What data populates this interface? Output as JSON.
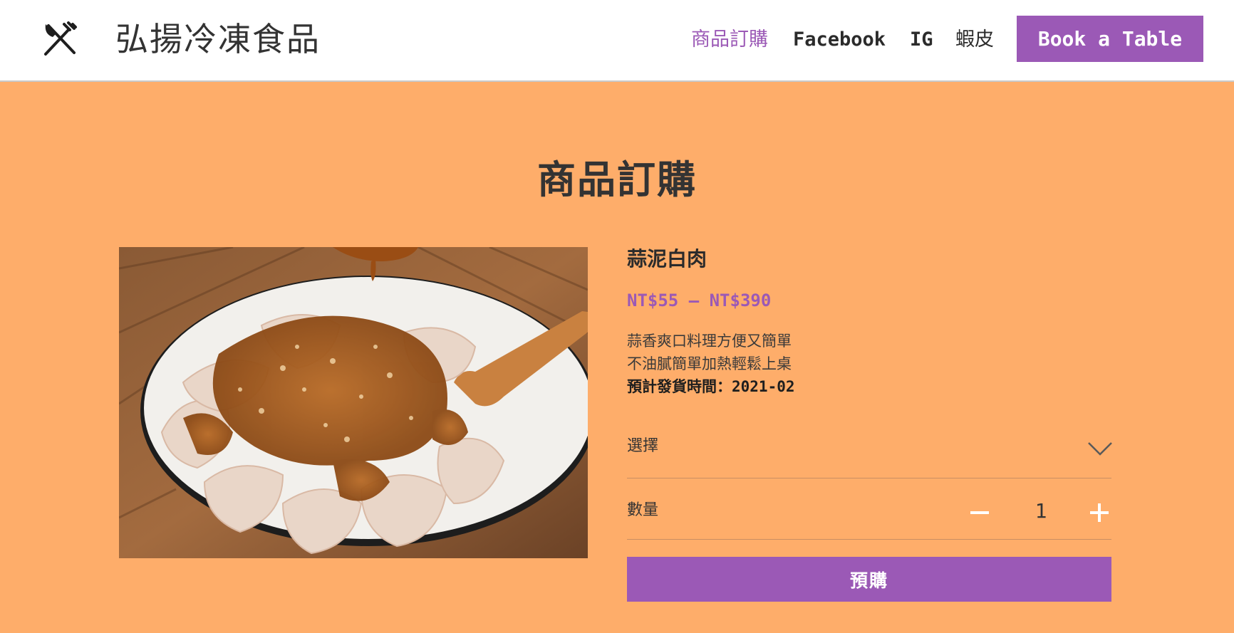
{
  "header": {
    "brand": "弘揚冷凍食品",
    "logo_icon": "fork-knife-icon",
    "nav": [
      {
        "label": "商品訂購",
        "active": true
      },
      {
        "label": "Facebook"
      },
      {
        "label": "IG"
      },
      {
        "label": "蝦皮"
      }
    ],
    "book_button": "Book a Table"
  },
  "page": {
    "title": "商品訂購"
  },
  "product": {
    "name": "蒜泥白肉",
    "price": "NT$55 – NT$390",
    "description": {
      "line1": "蒜香爽口料理方便又簡單",
      "line2": "不油膩簡單加熱輕鬆上桌",
      "ship_label": "預計發貨時間：",
      "ship_value": "2021-02"
    },
    "option_select": {
      "label": "選擇",
      "icon": "chevron-down-icon"
    },
    "quantity": {
      "label": "數量",
      "value": "1",
      "minus_icon": "minus-icon",
      "plus_icon": "plus-icon"
    },
    "preorder_button": "預購"
  },
  "colors": {
    "background": "#fead6a",
    "accent": "#9b59b6",
    "header_bg": "#ffffff"
  }
}
